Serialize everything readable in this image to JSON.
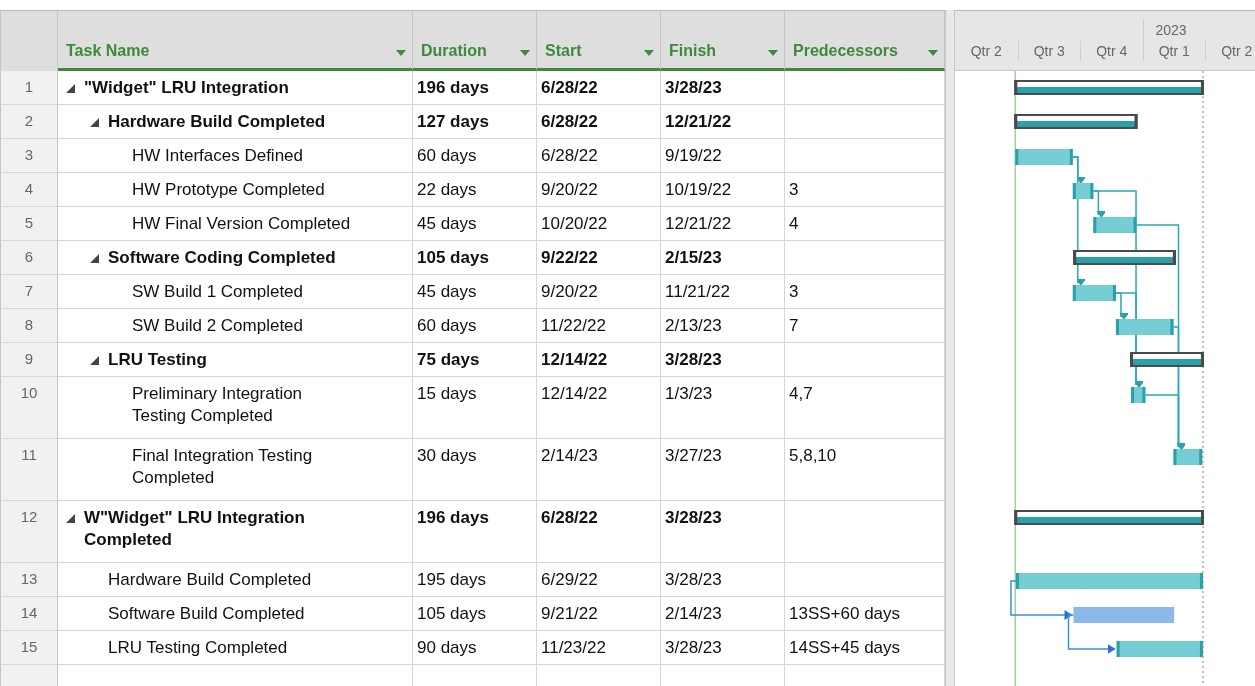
{
  "table": {
    "columns": [
      {
        "label": "Task Name"
      },
      {
        "label": "Duration"
      },
      {
        "label": "Start"
      },
      {
        "label": "Finish"
      },
      {
        "label": "Predecessors"
      }
    ],
    "rows": [
      {
        "num": "1",
        "name": "\"Widget\" LRU Integration",
        "kind": "summary",
        "expanded": true,
        "duration": "196 days",
        "start": "6/28/22",
        "finish": "3/28/23",
        "children": [
          {
            "num": "2",
            "name": "Hardware Build Completed",
            "kind": "summary",
            "expanded": true,
            "duration": "127 days",
            "start": "6/28/22",
            "finish": "12/21/22",
            "children": [
              {
                "num": "3",
                "name": "HW Interfaces Defined",
                "kind": "task",
                "duration": "60 days",
                "start": "6/28/22",
                "finish": "9/19/22"
              },
              {
                "num": "4",
                "name": "HW Prototype Completed",
                "kind": "task",
                "duration": "22 days",
                "start": "9/20/22",
                "finish": "10/19/22",
                "predecessors": "3"
              },
              {
                "num": "5",
                "name": "HW Final Version Completed",
                "kind": "task",
                "duration": "45 days",
                "start": "10/20/22",
                "finish": "12/21/22",
                "predecessors": "4"
              }
            ]
          },
          {
            "num": "6",
            "name": "Software Coding Completed",
            "kind": "summary",
            "expanded": true,
            "duration": "105 days",
            "start": "9/22/22",
            "finish": "2/15/23",
            "children": [
              {
                "num": "7",
                "name": "SW Build 1 Completed",
                "kind": "task",
                "duration": "45 days",
                "start": "9/20/22",
                "finish": "11/21/22",
                "predecessors": "3"
              },
              {
                "num": "8",
                "name": "SW Build 2 Completed",
                "kind": "task",
                "duration": "60 days",
                "start": "11/22/22",
                "finish": "2/13/23",
                "predecessors": "7"
              }
            ]
          },
          {
            "num": "9",
            "name": "LRU Testing",
            "kind": "summary",
            "expanded": true,
            "duration": "75 days",
            "start": "12/14/22",
            "finish": "3/28/23",
            "children": [
              {
                "num": "10",
                "name": "Preliminary Integration\nTesting Completed",
                "kind": "task",
                "duration": "15 days",
                "start": "12/14/22",
                "finish": "1/3/23",
                "predecessors": "4,7"
              },
              {
                "num": "11",
                "name": "Final Integration Testing\nCompleted",
                "kind": "task",
                "duration": "30 days",
                "start": "2/14/23",
                "finish": "3/27/23",
                "predecessors": "5,8,10"
              }
            ]
          }
        ]
      },
      {
        "num": "12",
        "name": "W\"Widget\" LRU Integration\nCompleted",
        "kind": "summary",
        "expanded": true,
        "duration": "196 days",
        "start": "6/28/22",
        "finish": "3/28/23",
        "children": [
          {
            "num": "13",
            "name": "Hardware Build Completed",
            "kind": "task",
            "duration": "195 days",
            "start": "6/29/22",
            "finish": "3/28/23"
          },
          {
            "num": "14",
            "name": "Software Build Completed",
            "kind": "manual",
            "duration": "105 days",
            "start": "9/21/22",
            "finish": "2/14/23",
            "predecessors": "13SS+60 days"
          },
          {
            "num": "15",
            "name": "LRU Testing Completed",
            "kind": "task",
            "duration": "90 days",
            "start": "11/23/22",
            "finish": "3/28/23",
            "predecessors": "14SS+45 days"
          }
        ]
      }
    ]
  },
  "timescale": {
    "year": "2023",
    "quarters": [
      "Qtr 2",
      "Qtr 3",
      "Qtr 4",
      "Qtr 1",
      "Qtr 2"
    ]
  }
}
